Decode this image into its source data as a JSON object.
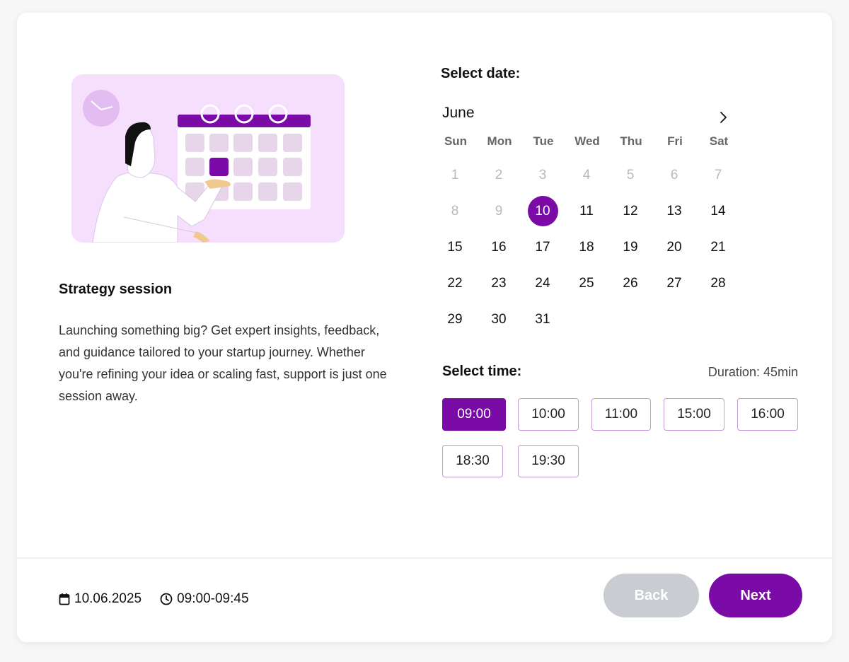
{
  "session": {
    "title": "Strategy session",
    "description": "Launching something big? Get expert insights, feedback, and guidance tailored to your startup journey. Whether you're refining your idea or scaling fast, support is just one session away."
  },
  "calendar": {
    "heading": "Select date:",
    "month": "June",
    "next_icon": "chevron-right-icon",
    "weekdays": [
      "Sun",
      "Mon",
      "Tue",
      "Wed",
      "Thu",
      "Fri",
      "Sat"
    ],
    "days": [
      {
        "label": "1",
        "state": "disabled"
      },
      {
        "label": "2",
        "state": "disabled"
      },
      {
        "label": "3",
        "state": "disabled"
      },
      {
        "label": "4",
        "state": "disabled"
      },
      {
        "label": "5",
        "state": "disabled"
      },
      {
        "label": "6",
        "state": "disabled"
      },
      {
        "label": "7",
        "state": "disabled"
      },
      {
        "label": "8",
        "state": "disabled"
      },
      {
        "label": "9",
        "state": "disabled"
      },
      {
        "label": "10",
        "state": "selected"
      },
      {
        "label": "11",
        "state": "available"
      },
      {
        "label": "12",
        "state": "available"
      },
      {
        "label": "13",
        "state": "available"
      },
      {
        "label": "14",
        "state": "available"
      },
      {
        "label": "15",
        "state": "available"
      },
      {
        "label": "16",
        "state": "available"
      },
      {
        "label": "17",
        "state": "available"
      },
      {
        "label": "18",
        "state": "available"
      },
      {
        "label": "19",
        "state": "available"
      },
      {
        "label": "20",
        "state": "available"
      },
      {
        "label": "21",
        "state": "available"
      },
      {
        "label": "22",
        "state": "available"
      },
      {
        "label": "23",
        "state": "available"
      },
      {
        "label": "24",
        "state": "available"
      },
      {
        "label": "25",
        "state": "available"
      },
      {
        "label": "26",
        "state": "available"
      },
      {
        "label": "27",
        "state": "available"
      },
      {
        "label": "28",
        "state": "available"
      },
      {
        "label": "29",
        "state": "available"
      },
      {
        "label": "30",
        "state": "available"
      },
      {
        "label": "31",
        "state": "available"
      }
    ]
  },
  "time": {
    "heading": "Select time:",
    "duration": "Duration: 45min",
    "slots": [
      {
        "label": "09:00",
        "selected": true
      },
      {
        "label": "10:00",
        "selected": false
      },
      {
        "label": "11:00",
        "selected": false
      },
      {
        "label": "15:00",
        "selected": false
      },
      {
        "label": "16:00",
        "selected": false
      },
      {
        "label": "18:30",
        "selected": false
      },
      {
        "label": "19:30",
        "selected": false
      }
    ]
  },
  "footer": {
    "date": "10.06.2025",
    "time": "09:00-09:45",
    "date_icon": "calendar-icon",
    "time_icon": "clock-icon",
    "back_label": "Back",
    "next_label": "Next"
  },
  "colors": {
    "accent": "#7a0ba6",
    "illustration_bg": "#f5dffc",
    "disabled_button": "#c9cdd2"
  }
}
